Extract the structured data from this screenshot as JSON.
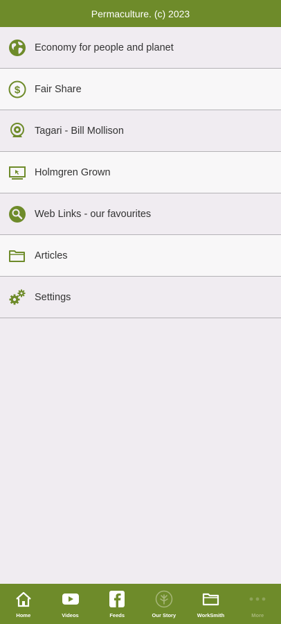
{
  "header": {
    "title": "Permaculture. (c) 2023"
  },
  "menu": {
    "items": [
      {
        "label": "Economy for people and planet",
        "icon": "globe-icon"
      },
      {
        "label": "Fair Share",
        "icon": "dollar-icon"
      },
      {
        "label": "Tagari - Bill Mollison",
        "icon": "webcam-icon"
      },
      {
        "label": "Holmgren Grown",
        "icon": "monitor-icon"
      },
      {
        "label": "Web Links - our favourites",
        "icon": "search-icon"
      },
      {
        "label": "Articles",
        "icon": "folder-icon"
      },
      {
        "label": "Settings",
        "icon": "gears-icon"
      }
    ]
  },
  "tabbar": {
    "tabs": [
      {
        "label": "Home",
        "icon": "home-icon"
      },
      {
        "label": "Videos",
        "icon": "youtube-icon"
      },
      {
        "label": "Feeds",
        "icon": "facebook-icon"
      },
      {
        "label": "Our Story",
        "icon": "leaf-icon"
      },
      {
        "label": "WorkSmith",
        "icon": "folder-icon"
      },
      {
        "label": "More",
        "icon": "more-dots-icon"
      }
    ]
  },
  "colors": {
    "brand": "#6e8b2a",
    "icon": "#6e8b2a",
    "background": "#f0ecf1",
    "divider": "#b4b2b6"
  }
}
